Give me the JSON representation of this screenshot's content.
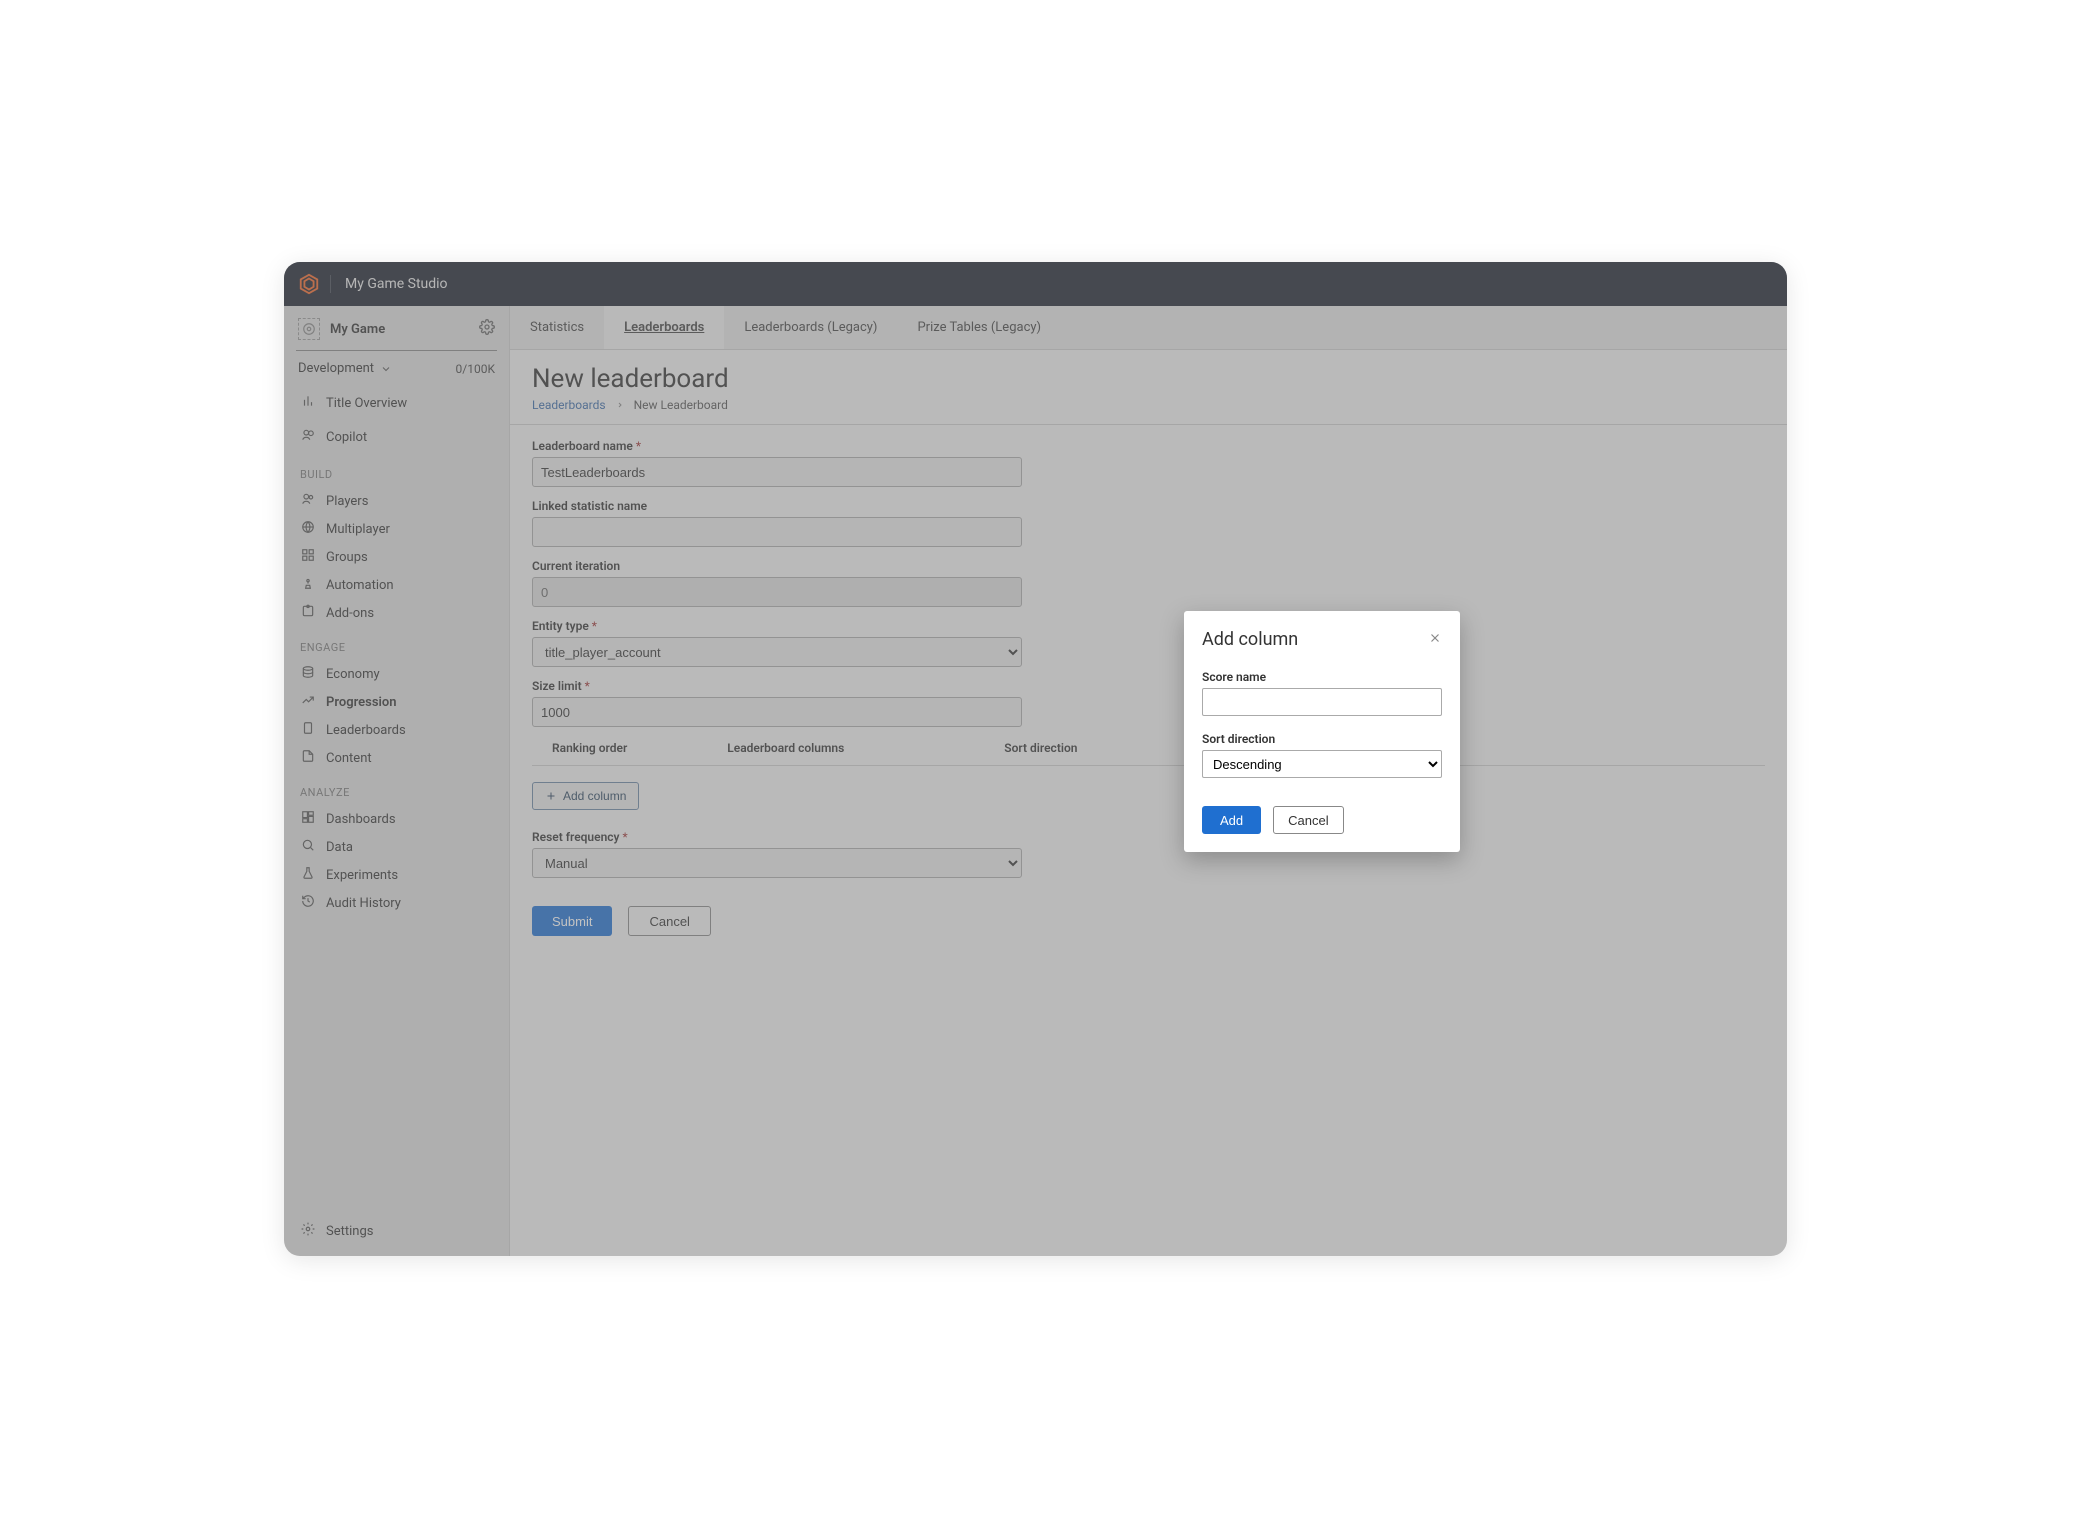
{
  "topbar": {
    "studio": "My Game Studio"
  },
  "sidebar": {
    "game_name": "My Game",
    "environment_label": "Development",
    "usage_meter": "0/100K",
    "items_top": [
      {
        "label": "Title Overview",
        "icon": "chart-bar"
      },
      {
        "label": "Copilot",
        "icon": "sparkle"
      }
    ],
    "sections": [
      {
        "label": "BUILD",
        "items": [
          {
            "label": "Players",
            "icon": "users"
          },
          {
            "label": "Multiplayer",
            "icon": "globe"
          },
          {
            "label": "Groups",
            "icon": "blocks"
          },
          {
            "label": "Automation",
            "icon": "robot"
          },
          {
            "label": "Add-ons",
            "icon": "puzzle"
          }
        ]
      },
      {
        "label": "ENGAGE",
        "items": [
          {
            "label": "Economy",
            "icon": "coins"
          },
          {
            "label": "Progression",
            "icon": "trend",
            "active": true
          },
          {
            "label": "Leaderboards",
            "icon": "board"
          },
          {
            "label": "Content",
            "icon": "file"
          }
        ]
      },
      {
        "label": "ANALYZE",
        "items": [
          {
            "label": "Dashboards",
            "icon": "dashboard"
          },
          {
            "label": "Data",
            "icon": "search"
          },
          {
            "label": "Experiments",
            "icon": "flask"
          },
          {
            "label": "Audit History",
            "icon": "clock"
          }
        ]
      }
    ],
    "settings_label": "Settings"
  },
  "tabs": [
    {
      "label": "Statistics"
    },
    {
      "label": "Leaderboards",
      "active": true
    },
    {
      "label": "Leaderboards (Legacy)"
    },
    {
      "label": "Prize Tables (Legacy)"
    }
  ],
  "page": {
    "title": "New leaderboard",
    "breadcrumb": {
      "link": "Leaderboards",
      "current": "New Leaderboard"
    },
    "labels": {
      "name": "Leaderboard name",
      "linked_stat": "Linked statistic name",
      "current_iteration": "Current iteration",
      "entity_type": "Entity type",
      "size_limit": "Size limit",
      "reset_frequency": "Reset frequency"
    },
    "values": {
      "name": "TestLeaderboards",
      "linked_stat": "",
      "current_iteration": "0",
      "entity_type": "title_player_account",
      "size_limit": "1000",
      "reset_frequency": "Manual"
    },
    "columns_headers": {
      "ranking_order": "Ranking order",
      "leaderboard_columns": "Leaderboard columns",
      "sort_direction": "Sort direction"
    },
    "add_column_btn": "Add column",
    "submit": "Submit",
    "cancel": "Cancel"
  },
  "modal": {
    "title": "Add column",
    "score_name_label": "Score name",
    "score_name_value": "",
    "sort_direction_label": "Sort direction",
    "sort_direction_value": "Descending",
    "add": "Add",
    "cancel": "Cancel"
  }
}
